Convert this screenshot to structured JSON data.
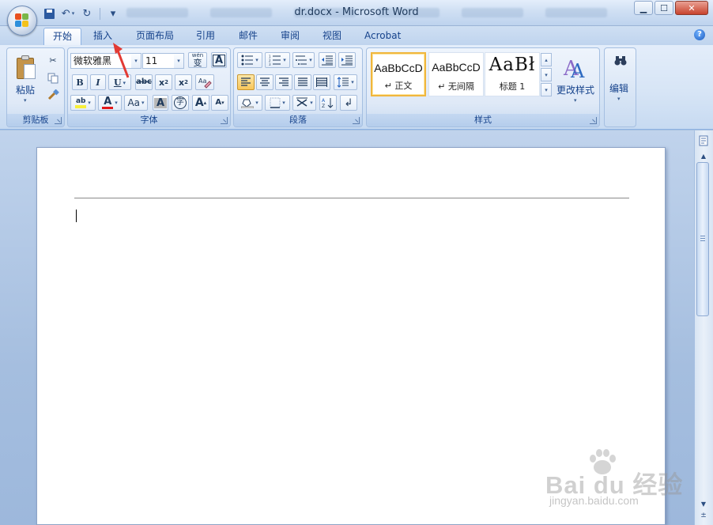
{
  "window": {
    "title": "dr.docx - Microsoft Word",
    "controls": {
      "minimize": "▁",
      "maximize": "☐",
      "close": "✕"
    }
  },
  "qat": {
    "undo": "↶",
    "redo": "↻",
    "customize": "▾"
  },
  "tabs": [
    {
      "label": "开始",
      "active": true
    },
    {
      "label": "插入",
      "active": false
    },
    {
      "label": "页面布局",
      "active": false
    },
    {
      "label": "引用",
      "active": false
    },
    {
      "label": "邮件",
      "active": false
    },
    {
      "label": "审阅",
      "active": false
    },
    {
      "label": "视图",
      "active": false
    },
    {
      "label": "Acrobat",
      "active": false
    }
  ],
  "help": "?",
  "ribbon": {
    "clipboard": {
      "label": "剪贴板",
      "paste_label": "粘贴"
    },
    "font": {
      "label": "字体",
      "font_name": "微软雅黑",
      "font_size": "11",
      "grow_font": "A",
      "shrink_font": "A",
      "wen": "wén",
      "wen_char": "变",
      "char_border": "A",
      "bold": "B",
      "italic": "I",
      "underline": "U",
      "strikethrough": "abc",
      "subscript": "x",
      "superscript": "x",
      "clear_format": "A",
      "highlight": "ab",
      "font_color": "A",
      "change_case": "Aa",
      "char_shading": "A",
      "enclose_char": "字"
    },
    "paragraph": {
      "label": "段落"
    },
    "styles": {
      "label": "样式",
      "items": [
        {
          "sample": "AaBbCcD",
          "name": "↵ 正文",
          "selected": true
        },
        {
          "sample": "AaBbCcD",
          "name": "↵ 无间隔",
          "selected": false
        },
        {
          "sample": "AaBł",
          "name": "标题 1",
          "selected": false
        }
      ],
      "change_styles": "更改样式"
    },
    "editing": {
      "label": "编辑"
    }
  },
  "watermark": {
    "text": "Bai  du 经验",
    "url": "jingyan.baidu.com"
  },
  "colors": {
    "accent": "#15428b",
    "highlight": "#f8ef3a",
    "font_color": "#e21b1b",
    "annotation_arrow": "#e23a34"
  }
}
